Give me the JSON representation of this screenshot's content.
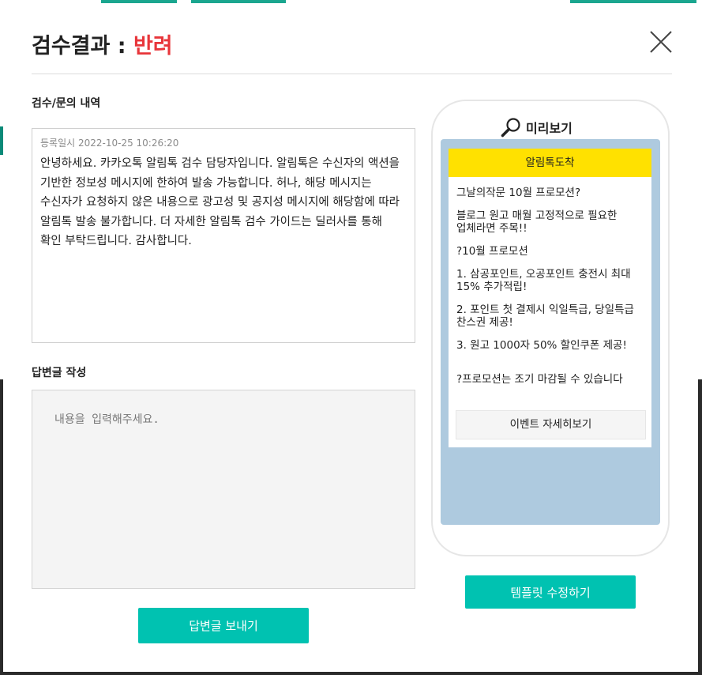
{
  "modal": {
    "title_prefix": "검수결과 : ",
    "title_status": "반려",
    "status_color": "#e8363b"
  },
  "inquiry": {
    "label": "검수/문의 내역",
    "date": "등록일시 2022-10-25 10:26:20",
    "content": "안녕하세요. 카카오톡 알림톡 검수 담당자입니다. 알림톡은 수신자의 액션을 기반한 정보성 메시지에 한하여 발송 가능합니다. 허나, 해당 메시지는 수신자가 요청하지 않은 내용으로 광고성 및 공지성 메시지에 해당함에 따라 알림톡 발송 불가합니다. 더 자세한 알림톡 검수 가이드는 딜러사를 통해 확인 부탁드립니다. 감사합니다."
  },
  "reply": {
    "label": "답변글 작성",
    "placeholder": "내용을 입력해주세요.",
    "send_button": "답변글 보내기"
  },
  "preview": {
    "title": "미리보기",
    "icon": "magnifier-icon",
    "header": "알림톡도착",
    "header_color": "#ffe100",
    "lines": [
      "그날의작문 10월 프로모션?",
      "블로그 원고 매월 고정적으로 필요한 업체라면 주목!!",
      "?10월 프로모션",
      "1. 삼공포인트, 오공포인트 충전시 최대 15% 추가적립!",
      "2. 포인트 첫 결제시 익일특급, 당일특급 찬스권 제공!",
      "3. 원고 1000자 50% 할인쿠폰 제공!",
      "?프로모션는 조기 마감될 수 있습니다"
    ],
    "event_button": "이벤트 자세히보기",
    "edit_button": "템플릿 수정하기"
  },
  "accent_color": "#00c2b1"
}
